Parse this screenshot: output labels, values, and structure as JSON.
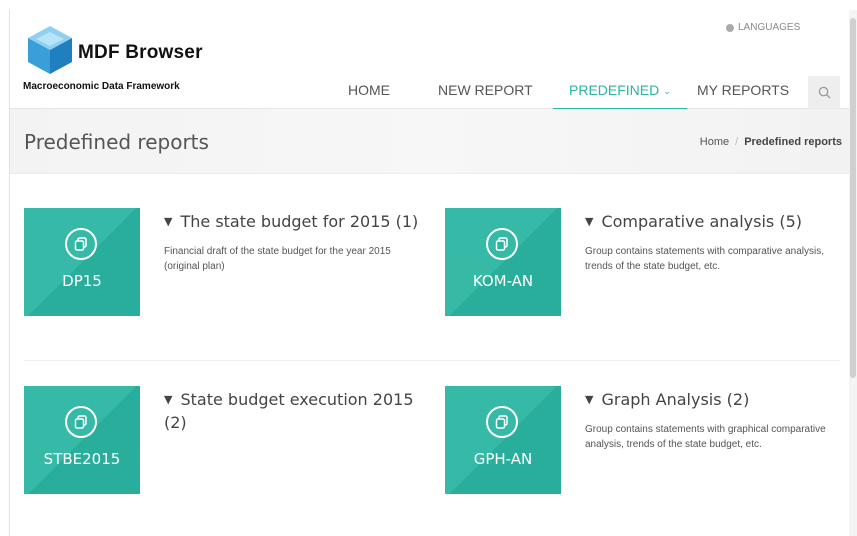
{
  "brand": {
    "title": "MDF Browser",
    "subtitle": "Macroeconomic Data Framework",
    "accent": "#2ab5a0",
    "logo_icon": "cube-icon"
  },
  "header": {
    "languages_label": "LANGUAGES",
    "nav": [
      {
        "label": "HOME",
        "active": false
      },
      {
        "label": "NEW REPORT",
        "active": false
      },
      {
        "label": "PREDEFINED",
        "active": true
      },
      {
        "label": "MY REPORTS",
        "active": false
      }
    ],
    "search_icon": "search-icon"
  },
  "titlebar": {
    "title": "Predefined reports",
    "breadcrumb": [
      "Home",
      "Predefined reports"
    ]
  },
  "reports": [
    {
      "code": "DP15",
      "title": "The state budget for 2015 (1)",
      "description": "Financial draft of the state budget for the year 2015 (original plan)"
    },
    {
      "code": "KOM-AN",
      "title": "Comparative analysis (5)",
      "description": "Group contains statements with comparative analysis, trends of the state budget, etc."
    },
    {
      "code": "STBE2015",
      "title": "State budget execution 2015 (2)",
      "description": ""
    },
    {
      "code": "GPH-AN",
      "title": "Graph Analysis (2)",
      "description": "Group contains statements with graphical comparative analysis, trends of the state budget, etc."
    }
  ]
}
